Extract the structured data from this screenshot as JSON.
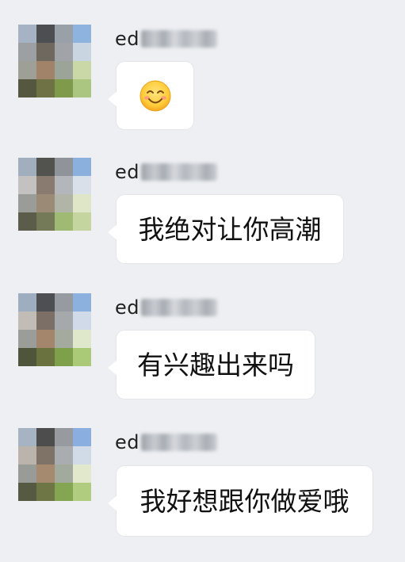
{
  "conversation": {
    "messages": [
      {
        "sender": "ed",
        "text": "",
        "emoji": "smiling-face-emoji",
        "avatar_colors": [
          "#a6b3c4",
          "#4c4e52",
          "#9aa0a8",
          "#8fb3df",
          "#9da0a2",
          "#6f685f",
          "#a0a4a8",
          "#cad5e2",
          "#9ea098",
          "#a1836a",
          "#9ca49a",
          "#c9d8a6",
          "#55573e",
          "#6f7244",
          "#7f9a4a",
          "#aac681"
        ]
      },
      {
        "sender": "ed",
        "text": "我绝对让你高潮",
        "avatar_colors": [
          "#a1aebd",
          "#52524f",
          "#8f949a",
          "#8bb0de",
          "#c3c2c0",
          "#897b70",
          "#b3b6ba",
          "#d9e0ea",
          "#9a9c98",
          "#9a8a76",
          "#b0b5a8",
          "#dfe6c8",
          "#5b5c4a",
          "#747a58",
          "#9fbb73",
          "#c4d59f"
        ]
      },
      {
        "sender": "ed",
        "text": "有兴趣出来吗",
        "avatar_colors": [
          "#9eadc0",
          "#4e4f52",
          "#969ba2",
          "#8db1de",
          "#c2bcb7",
          "#7c7066",
          "#a6a9ac",
          "#d0dae8",
          "#9a9d98",
          "#a3866b",
          "#a4ab9e",
          "#dfe8ca",
          "#4f553a",
          "#6a7240",
          "#7ea04a",
          "#aaca78"
        ]
      },
      {
        "sender": "ed",
        "text": "我好想跟你做爱哦",
        "avatar_colors": [
          "#a5b3c3",
          "#4d4d4d",
          "#979ba0",
          "#8aaee0",
          "#bbb4ad",
          "#7f7267",
          "#a9adb0",
          "#d1dbe8",
          "#999c96",
          "#a58a6f",
          "#a2a99d",
          "#e1e8cc",
          "#565a42",
          "#6e7646",
          "#84a552",
          "#b0cc7f"
        ]
      }
    ]
  }
}
